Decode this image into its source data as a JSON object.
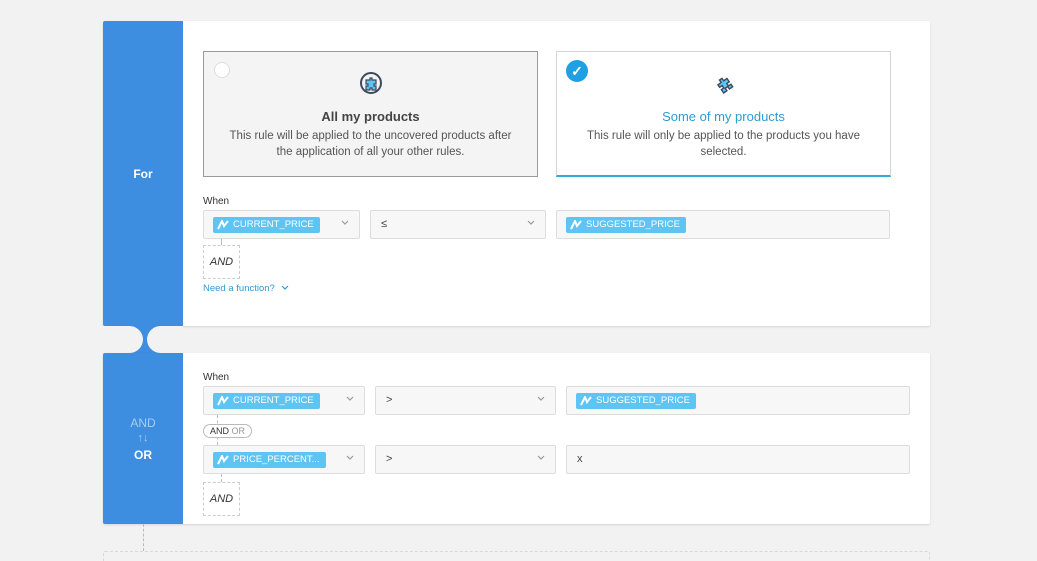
{
  "for_block": {
    "side_label": "For",
    "options": [
      {
        "title": "All my products",
        "description": "This rule will be applied to the uncovered products after the application of all your other rules.",
        "selected": false,
        "icon": "puzzle-circle-icon"
      },
      {
        "title": "Some of my products",
        "description": "This rule will only be applied to the products you have selected.",
        "selected": true,
        "icon": "puzzle-piece-icon"
      }
    ],
    "when_label": "When",
    "condition": {
      "field": "CURRENT_PRICE",
      "operator": "≤",
      "value": "SUGGESTED_PRICE"
    },
    "and_label": "AND",
    "need_function": "Need a function?"
  },
  "or_block": {
    "side_and": "AND",
    "side_arrows": "↑↓",
    "side_or": "OR",
    "when_label": "When",
    "conditions": [
      {
        "field": "CURRENT_PRICE",
        "operator": ">",
        "value": "SUGGESTED_PRICE"
      },
      {
        "field": "PRICE_PERCENT...",
        "operator": ">",
        "value": "x"
      }
    ],
    "pill_and": "AND",
    "pill_or": "OR",
    "and_label": "AND"
  },
  "colors": {
    "accent": "#3d8ee0",
    "tag": "#5ec4f4",
    "selected": "#2f9bd4",
    "check": "#1fa0e3"
  }
}
